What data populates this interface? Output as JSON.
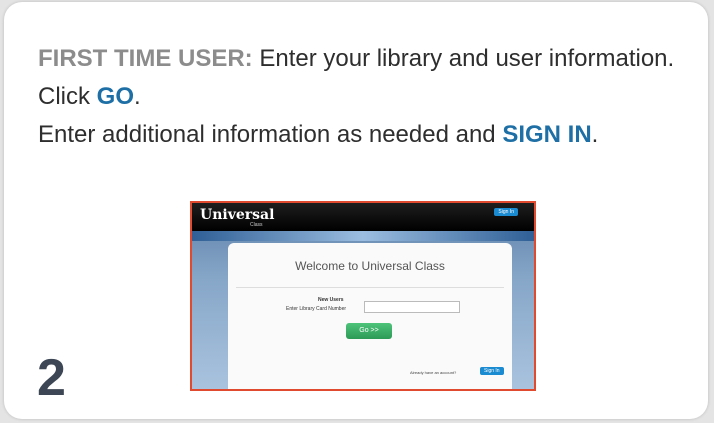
{
  "instructions": {
    "lead": "FIRST TIME USER:",
    "line1_rest": " Enter your library and user information.",
    "line2_prefix": "Click ",
    "line2_emph": "GO",
    "line2_suffix": ".",
    "line3_prefix": "Enter additional information as needed and ",
    "line3_emph": "SIGN IN",
    "line3_suffix": "."
  },
  "step_number": "2",
  "screenshot": {
    "logo": "Universal",
    "logo_sub": "Class",
    "top_signin": "Sign In",
    "welcome": "Welcome to Universal Class",
    "new_users": "New Users",
    "card_label": "Enter Library Card Number",
    "go_button": "Go >>",
    "already": "Already have an account?",
    "signin_button": "Sign In"
  },
  "colors": {
    "lead": "#8c8c8c",
    "emphasis": "#1d6fa5",
    "highlight_border": "#e04a2e",
    "go_button": "#2c9a55",
    "signin_button": "#1a8ad1"
  }
}
